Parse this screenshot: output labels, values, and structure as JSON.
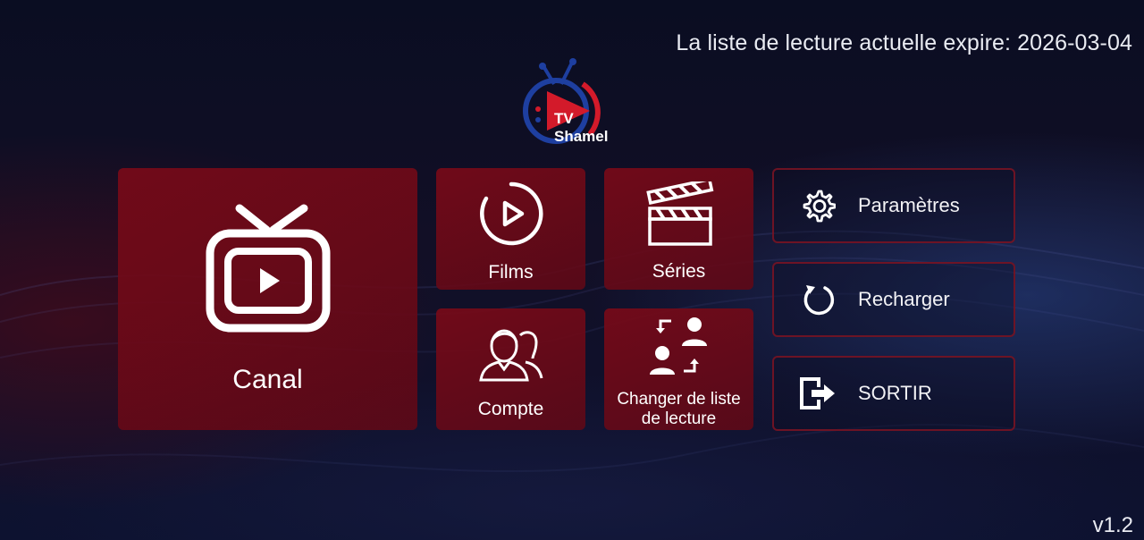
{
  "header": {
    "expire_text": "La liste de lecture actuelle expire: 2026-03-04"
  },
  "logo": {
    "line1": "TV",
    "line2": "Shamel"
  },
  "tiles": {
    "canal": {
      "label": "Canal",
      "icon": "tv-play-icon"
    },
    "films": {
      "label": "Films",
      "icon": "play-circle-icon"
    },
    "series": {
      "label": "Séries",
      "icon": "clapperboard-icon"
    },
    "compte": {
      "label": "Compte",
      "icon": "users-icon"
    },
    "changer": {
      "label_line1": "Changer de liste",
      "label_line2": "de lecture",
      "icon": "switch-users-icon"
    }
  },
  "side_menu": {
    "params": {
      "label": "Paramètres",
      "icon": "gear-icon"
    },
    "reload": {
      "label": "Recharger",
      "icon": "reload-icon"
    },
    "exit": {
      "label": "SORTIR",
      "icon": "exit-icon"
    }
  },
  "footer": {
    "version": "v1.2"
  },
  "colors": {
    "tile_red": "#78091a",
    "side_border": "#78142a",
    "logo_blue": "#1e3fa0",
    "logo_red": "#d31a2a"
  }
}
